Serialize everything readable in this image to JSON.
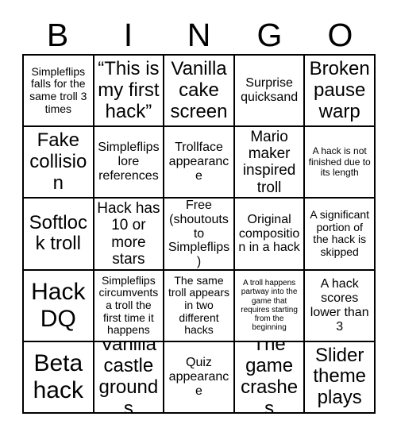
{
  "card": {
    "title": "BINGO",
    "header_letters": [
      "B",
      "I",
      "N",
      "G",
      "O"
    ],
    "columns": 5,
    "rows": 5,
    "border_color": "#000000",
    "background_color": "#ffffff",
    "text_color": "#000000",
    "cells": [
      {
        "text": "Simpleflips falls for the same troll 3 times",
        "size": "s",
        "free": false
      },
      {
        "text": "“This is my first hack”",
        "size": "xl",
        "free": false
      },
      {
        "text": "Vanilla cake screen",
        "size": "xl",
        "free": false
      },
      {
        "text": "Surprise quicksand",
        "size": "m",
        "free": false
      },
      {
        "text": "Broken pause warp",
        "size": "xl",
        "free": false
      },
      {
        "text": "Fake collision",
        "size": "xl",
        "free": false
      },
      {
        "text": "Simpleflips lore references",
        "size": "m",
        "free": false
      },
      {
        "text": "Trollface appearance",
        "size": "m",
        "free": false
      },
      {
        "text": "Mario maker inspired troll",
        "size": "l",
        "free": false
      },
      {
        "text": "A hack is not finished due to its length",
        "size": "xs",
        "free": false
      },
      {
        "text": "Softlock troll",
        "size": "xl",
        "free": false
      },
      {
        "text": "Hack has 10 or more stars",
        "size": "l",
        "free": false
      },
      {
        "text": "Free (shoutouts to Simpleflips)",
        "size": "m",
        "free": true
      },
      {
        "text": "Original composition in a hack",
        "size": "m",
        "free": false
      },
      {
        "text": "A significant portion of the hack is skipped",
        "size": "s",
        "free": false
      },
      {
        "text": "Hack DQ",
        "size": "xxl",
        "free": false
      },
      {
        "text": "Simpleflips circumvents a troll the first time it happens",
        "size": "s",
        "free": false
      },
      {
        "text": "The same troll appears in two different hacks",
        "size": "s",
        "free": false
      },
      {
        "text": "A troll happens partway into the game that requires starting from the beginning",
        "size": "xxs",
        "free": false
      },
      {
        "text": "A hack scores lower than 3",
        "size": "m",
        "free": false
      },
      {
        "text": "Beta hack",
        "size": "xxl",
        "free": false
      },
      {
        "text": "Vanilla castle grounds",
        "size": "xl",
        "free": false
      },
      {
        "text": "Quiz appearance",
        "size": "m",
        "free": false
      },
      {
        "text": "The game crashes",
        "size": "xl",
        "free": false
      },
      {
        "text": "Slider theme plays",
        "size": "xl",
        "free": false
      }
    ]
  }
}
